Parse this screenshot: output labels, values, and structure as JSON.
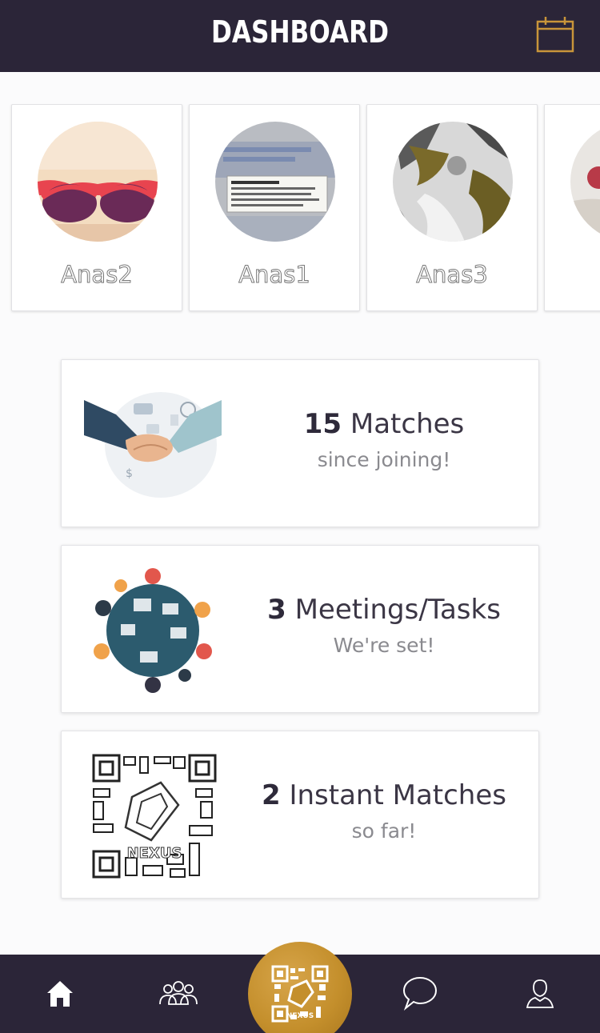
{
  "header": {
    "title": "DASHBOARD",
    "calendar_icon": "calendar-icon"
  },
  "profiles": [
    {
      "name": "Anas2",
      "avatar": "sunglasses-face"
    },
    {
      "name": "Anas1",
      "avatar": "screen-tooltip"
    },
    {
      "name": "Anas3",
      "avatar": "waterfall-rocks"
    },
    {
      "name": "A",
      "avatar": "snowy-scene"
    }
  ],
  "stats": [
    {
      "number": "15",
      "label": "Matches",
      "sub": "since joining!",
      "icon": "handshake-illustration"
    },
    {
      "number": "3",
      "label": "Meetings/Tasks",
      "sub": "We're set!",
      "icon": "meeting-table-illustration"
    },
    {
      "number": "2",
      "label": "Instant Matches",
      "sub": "so far!",
      "icon": "qr-code-illustration",
      "qr_caption": "NEXUS"
    }
  ],
  "nav": {
    "items": [
      "home-icon",
      "people-icon",
      "qr-scan-button",
      "chat-icon",
      "profile-icon"
    ],
    "center_caption": "NEXUS"
  },
  "colors": {
    "header_bg": "#2b2538",
    "accent_gold": "#c48f2c",
    "page_bg": "#fbfbfc"
  }
}
